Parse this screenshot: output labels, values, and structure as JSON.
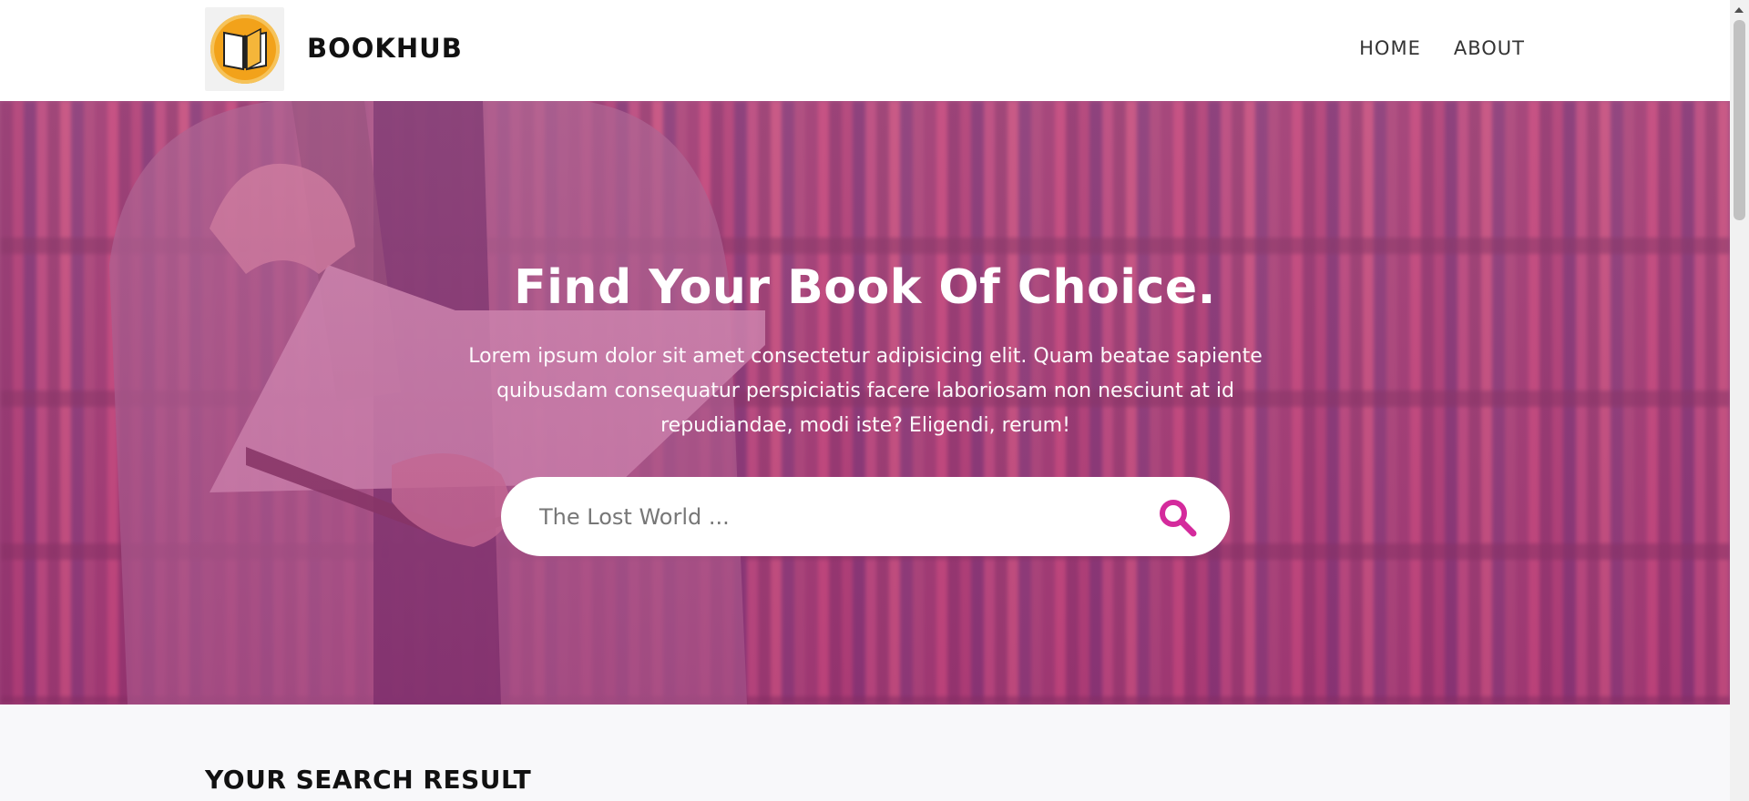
{
  "navbar": {
    "brand": "BOOKHUB",
    "links": [
      "HOME",
      "ABOUT"
    ]
  },
  "hero": {
    "title": "Find Your Book Of Choice.",
    "text": "Lorem ipsum dolor sit amet consectetur adipisicing elit. Quam beatae sapiente quibusdam consequatur perspiciatis facere laboriosam non nesciunt at id repudiandae, modi iste? Eligendi, rerum!",
    "search_placeholder": "The Lost World ..."
  },
  "results": {
    "title": "YOUR SEARCH RESULT"
  },
  "colors": {
    "accent": "#d42a9c",
    "logo_orange": "#f2a21a",
    "hero_overlay": "#b8468a"
  },
  "icons": [
    "book-logo-icon",
    "search-icon"
  ]
}
